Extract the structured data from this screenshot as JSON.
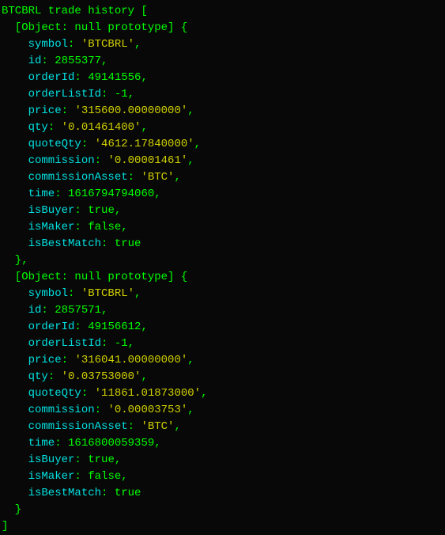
{
  "title_prefix": "BTCBRL trade history",
  "object_label": "[Object: null prototype]",
  "fields": {
    "symbol": "symbol",
    "id": "id",
    "orderId": "orderId",
    "orderListId": "orderListId",
    "price": "price",
    "qty": "qty",
    "quoteQty": "quoteQty",
    "commission": "commission",
    "commissionAsset": "commissionAsset",
    "time": "time",
    "isBuyer": "isBuyer",
    "isMaker": "isMaker",
    "isBestMatch": "isBestMatch"
  },
  "trades": [
    {
      "symbol": "'BTCBRL'",
      "id": "2855377",
      "orderId": "49141556",
      "orderListId": "-1",
      "price": "'315600.00000000'",
      "qty": "'0.01461400'",
      "quoteQty": "'4612.17840000'",
      "commission": "'0.00001461'",
      "commissionAsset": "'BTC'",
      "time": "1616794794060",
      "isBuyer": "true",
      "isMaker": "false",
      "isBestMatch": "true"
    },
    {
      "symbol": "'BTCBRL'",
      "id": "2857571",
      "orderId": "49156612",
      "orderListId": "-1",
      "price": "'316041.00000000'",
      "qty": "'0.03753000'",
      "quoteQty": "'11861.01873000'",
      "commission": "'0.00003753'",
      "commissionAsset": "'BTC'",
      "time": "1616800059359",
      "isBuyer": "true",
      "isMaker": "false",
      "isBestMatch": "true"
    }
  ]
}
